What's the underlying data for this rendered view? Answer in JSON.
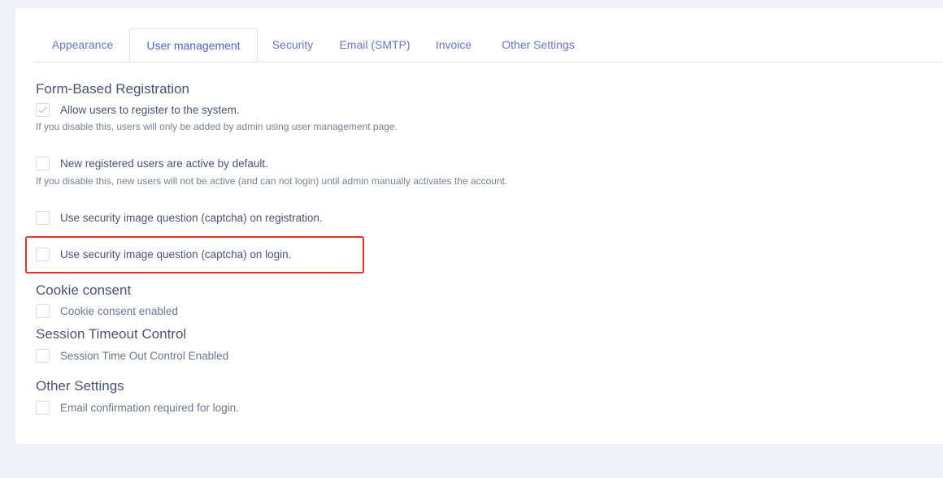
{
  "tabs": [
    {
      "label": "Appearance",
      "active": false
    },
    {
      "label": "User management",
      "active": true
    },
    {
      "label": "Security",
      "active": false
    },
    {
      "label": "Email (SMTP)",
      "active": false
    },
    {
      "label": "Invoice",
      "active": false
    },
    {
      "label": "Other Settings",
      "active": false
    }
  ],
  "form_registration": {
    "title": "Form-Based Registration",
    "allow_register": {
      "label": "Allow users to register to the system.",
      "checked": true,
      "help": "If you disable this, users will only be added by admin using user management page."
    },
    "active_default": {
      "label": "New registered users are active by default.",
      "checked": false,
      "help": "If you disable this, new users will not be active (and can not login) until admin manually activates the account."
    },
    "captcha_registration": {
      "label": "Use security image question (captcha) on registration.",
      "checked": false
    },
    "captcha_login": {
      "label": "Use security image question (captcha) on login.",
      "checked": false
    }
  },
  "cookie_consent": {
    "title": "Cookie consent",
    "enabled": {
      "label": "Cookie consent enabled",
      "checked": false
    }
  },
  "session_timeout": {
    "title": "Session Timeout Control",
    "enabled": {
      "label": "Session Time Out Control Enabled",
      "checked": false
    }
  },
  "other_settings": {
    "title": "Other Settings",
    "email_confirmation": {
      "label": "Email confirmation required for login.",
      "checked": false
    }
  },
  "colors": {
    "tab_text": "#6b75c9",
    "highlight": "#e5322d",
    "background": "#f0f1f6"
  }
}
